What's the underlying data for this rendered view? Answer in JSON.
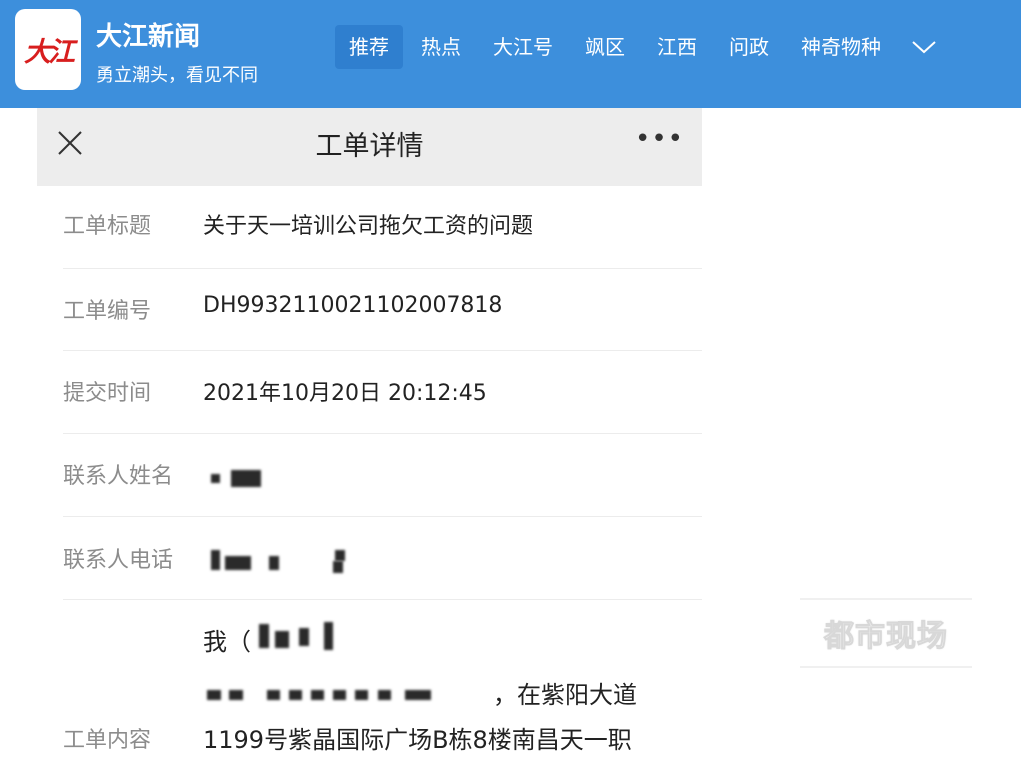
{
  "app": {
    "logo_text": "大江",
    "name": "大江新闻",
    "slogan": "勇立潮头，看见不同",
    "brand_color": "#3d8fdc",
    "logo_color": "#d81e1e"
  },
  "nav_tabs": [
    {
      "label": "推荐",
      "active": true
    },
    {
      "label": "热点"
    },
    {
      "label": "大江号"
    },
    {
      "label": "飒区"
    },
    {
      "label": "江西"
    },
    {
      "label": "问政"
    },
    {
      "label": "神奇物种"
    }
  ],
  "nav_more_icon": "chevron-down-icon",
  "screen": {
    "title": "工单详情",
    "close_icon": "close-icon",
    "more_icon": "more-icon",
    "fields": {
      "title": {
        "label": "工单标题",
        "value": "关于天一培训公司拖欠工资的问题"
      },
      "number": {
        "label": "工单编号",
        "value": "DH9932110021102007818"
      },
      "time": {
        "label": "提交时间",
        "value": "2021年10月20日  20:12:45"
      },
      "contact_name": {
        "label": "联系人姓名"
      },
      "contact_phone": {
        "label": "联系人电话"
      },
      "content": {
        "label": "工单内容",
        "line1": "我（",
        "line2": "，在紫阳大道",
        "line3": "1199号紫晶国际广场B栋8楼南昌天一职"
      }
    }
  },
  "watermark": "都市现场"
}
